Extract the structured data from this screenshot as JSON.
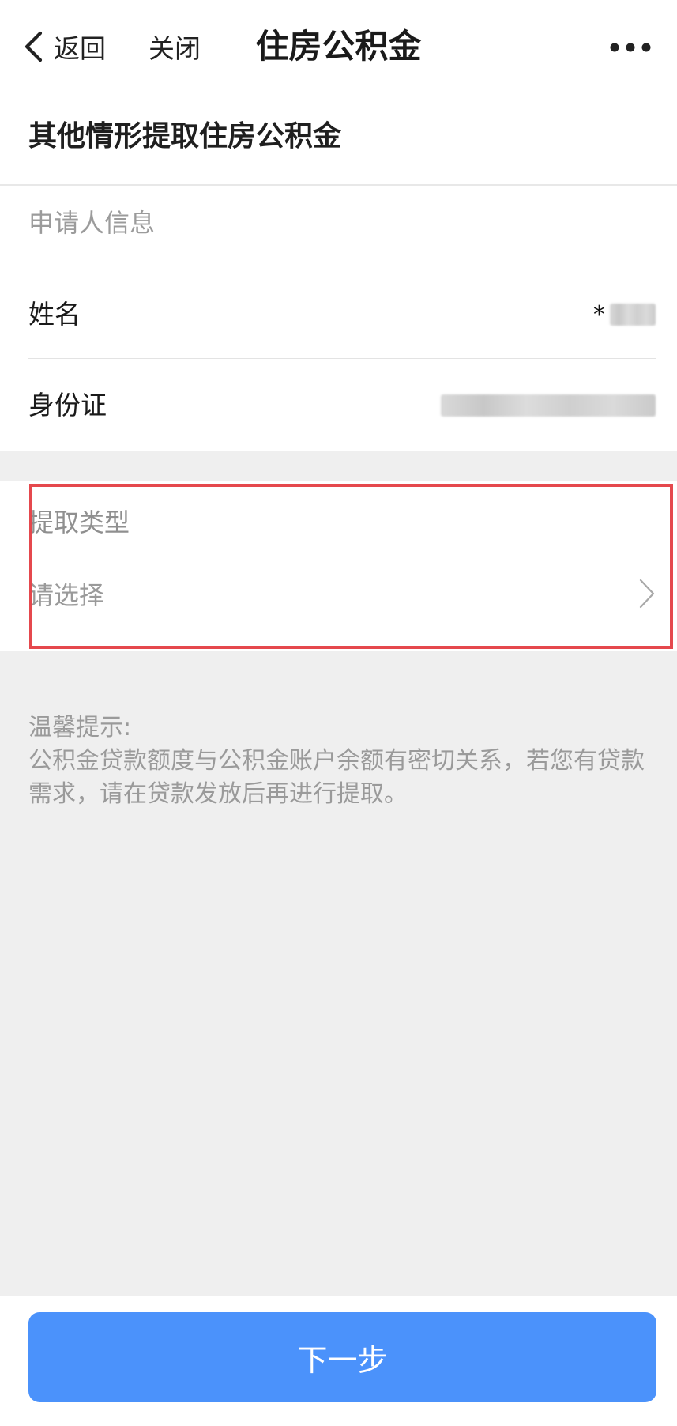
{
  "nav": {
    "back_label": "返回",
    "close_label": "关闭",
    "title": "住房公积金",
    "more_icon": "more-dots-icon",
    "back_icon": "chevron-left-icon"
  },
  "page": {
    "header_title": "其他情形提取住房公积金"
  },
  "applicant": {
    "section_title": "申请人信息",
    "name_label": "姓名",
    "name_value_prefix": "*",
    "id_label": "身份证"
  },
  "withdraw": {
    "label": "提取类型",
    "placeholder": "请选择",
    "chevron_icon": "chevron-right-icon",
    "highlight_color": "#e5484d"
  },
  "tips": {
    "title": "温馨提示:",
    "body": "公积金贷款额度与公积金账户余额有密切关系，若您有贷款需求，请在贷款发放后再进行提取。"
  },
  "footer": {
    "next_label": "下一步",
    "button_color": "#4b92fb"
  }
}
